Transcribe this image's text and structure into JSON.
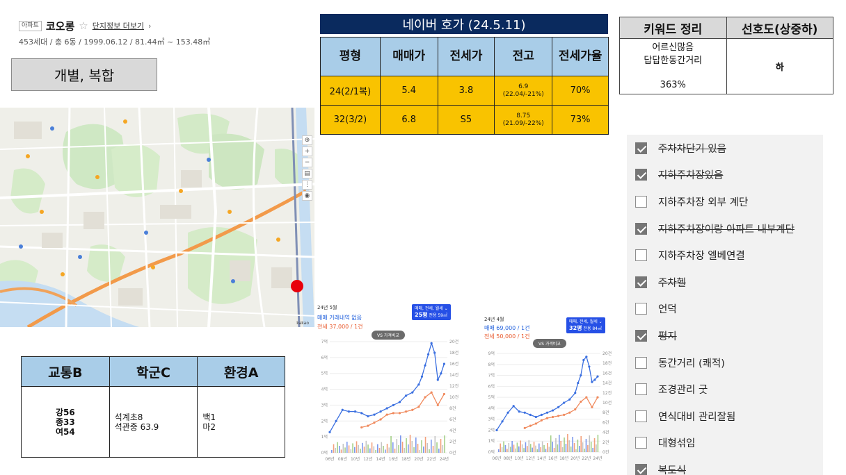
{
  "apartment": {
    "type_badge": "아파트",
    "name": "코오롱",
    "complex_link": "단지정보 더보기",
    "meta": "453세대 / 총 6동 / 1999.06.12 / 81.44㎡ ~ 153.48㎡",
    "category": "개별, 복합"
  },
  "price_table": {
    "title": "네이버 호가 (24.5.11)",
    "headers": [
      "평형",
      "매매가",
      "전세가",
      "전고",
      "전세가율"
    ],
    "rows": [
      {
        "size": "24(2/1복)",
        "sale": "5.4",
        "jeonse": "3.8",
        "high": "6.9",
        "high_sub": "(22.04/-21%)",
        "ratio": "70%"
      },
      {
        "size": "32(3/2)",
        "sale": "6.8",
        "jeonse": "S5",
        "high": "8.75",
        "high_sub": "(21.09/-22%)",
        "ratio": "73%"
      }
    ]
  },
  "keyword_table": {
    "headers": [
      "키워드 정리",
      "선호도(상중하)"
    ],
    "keywords_line1": "어르신많음",
    "keywords_line2": "답답한동간거리",
    "rate": "363%",
    "preference": "하"
  },
  "checklist": [
    {
      "label": "주차차단기 있음",
      "checked": true,
      "struck": true
    },
    {
      "label": "지하주차장있음",
      "checked": true,
      "struck": true
    },
    {
      "label": "지하주차장 외부 계단",
      "checked": false,
      "struck": false
    },
    {
      "label": "지하주차장이랑 아파트 내부계단",
      "checked": true,
      "struck": true
    },
    {
      "label": "지하주차장 엘베연결",
      "checked": false,
      "struck": false
    },
    {
      "label": "주차헬",
      "checked": true,
      "struck": true
    },
    {
      "label": "언덕",
      "checked": false,
      "struck": false
    },
    {
      "label": "평지",
      "checked": true,
      "struck": true
    },
    {
      "label": "동간거리 (쾌적)",
      "checked": false,
      "struck": false
    },
    {
      "label": "조경관리 굿",
      "checked": false,
      "struck": false
    },
    {
      "label": "연식대비 관리잘됨",
      "checked": false,
      "struck": false
    },
    {
      "label": "대형섞임",
      "checked": false,
      "struck": false
    },
    {
      "label": "복도식",
      "checked": true,
      "struck": true
    }
  ],
  "score_table": {
    "headers": [
      "교통B",
      "학군C",
      "환경A"
    ],
    "transport": [
      "강56",
      "종33",
      "여54"
    ],
    "school": [
      "석계초8",
      "석관중 63.9"
    ],
    "environment": [
      "백1",
      "마2"
    ]
  },
  "map": {
    "scale_label": "kakao",
    "marker_color": "#e8000b"
  },
  "chart_data": [
    {
      "type": "line",
      "period": "24년 5월",
      "sale_text": "매매 거래내역 없음",
      "jeonse_text": "전세 37,000 / 1건",
      "filter_label": "매매, 전세, 월세",
      "size_label": "25평",
      "size_sub": "전용 59㎡",
      "compare_button": "VS 가격비교",
      "y_left_ticks": [
        "7억",
        "6억",
        "5억",
        "4억",
        "3억",
        "2억",
        "1억",
        "0억"
      ],
      "y_right_ticks": [
        "20건",
        "18건",
        "16건",
        "14건",
        "12건",
        "10건",
        "8건",
        "6건",
        "4건",
        "2건",
        "0건"
      ],
      "x_ticks": [
        "06년",
        "08년",
        "10년",
        "12년",
        "14년",
        "16년",
        "18년",
        "20년",
        "22년",
        "24년"
      ],
      "ylim": [
        0,
        7
      ],
      "series": [
        {
          "name": "매매",
          "color": "#3a6fe0",
          "x": [
            2006,
            2007,
            2008,
            2009,
            2010,
            2011,
            2012,
            2013,
            2014,
            2015,
            2016,
            2017,
            2018,
            2019,
            2020,
            2020.5,
            2021,
            2021.5,
            2022,
            2022.5,
            2023,
            2023.5,
            2024
          ],
          "values": [
            1.3,
            2.0,
            2.7,
            2.6,
            2.6,
            2.5,
            2.3,
            2.4,
            2.6,
            2.8,
            3.0,
            3.2,
            3.6,
            3.8,
            4.3,
            4.8,
            5.5,
            6.2,
            6.9,
            6.3,
            4.6,
            5.0,
            5.6
          ]
        },
        {
          "name": "전세",
          "color": "#f08a5d",
          "x": [
            2011,
            2012,
            2013,
            2014,
            2015,
            2016,
            2017,
            2018,
            2019,
            2020,
            2021,
            2022,
            2023,
            2024
          ],
          "values": [
            1.6,
            1.7,
            1.9,
            2.1,
            2.4,
            2.5,
            2.5,
            2.6,
            2.7,
            2.9,
            3.5,
            3.8,
            3.0,
            3.7
          ]
        }
      ]
    },
    {
      "type": "line",
      "period": "24년 4월",
      "sale_text": "매매 69,000 / 1건",
      "jeonse_text": "전세 50,000 / 1건",
      "filter_label": "매매, 전세, 월세",
      "size_label": "32평",
      "size_sub": "전용 84㎡",
      "compare_button": "VS 가격비교",
      "y_left_ticks": [
        "9억",
        "8억",
        "7억",
        "6억",
        "5억",
        "4억",
        "3억",
        "2억",
        "1억",
        "0억"
      ],
      "y_right_ticks": [
        "20건",
        "18건",
        "16건",
        "14건",
        "12건",
        "10건",
        "8건",
        "6건",
        "4건",
        "2건",
        "0건"
      ],
      "x_ticks": [
        "06년",
        "08년",
        "10년",
        "12년",
        "14년",
        "16년",
        "18년",
        "20년",
        "22년",
        "24년"
      ],
      "ylim": [
        0,
        9
      ],
      "series": [
        {
          "name": "매매",
          "color": "#3a6fe0",
          "x": [
            2006,
            2007,
            2008,
            2009,
            2010,
            2011,
            2012,
            2013,
            2014,
            2015,
            2016,
            2017,
            2018,
            2019,
            2020,
            2020.5,
            2021,
            2021.5,
            2022,
            2022.5,
            2023,
            2023.5,
            2024
          ],
          "values": [
            2.0,
            2.8,
            3.6,
            4.2,
            3.7,
            3.6,
            3.4,
            3.2,
            3.4,
            3.6,
            3.8,
            4.1,
            4.5,
            4.8,
            5.4,
            6.3,
            7.0,
            8.4,
            8.7,
            7.8,
            6.4,
            6.6,
            6.9
          ]
        },
        {
          "name": "전세",
          "color": "#f08a5d",
          "x": [
            2011,
            2012,
            2013,
            2014,
            2015,
            2016,
            2017,
            2018,
            2019,
            2020,
            2021,
            2022,
            2023,
            2024
          ],
          "values": [
            2.2,
            2.4,
            2.6,
            2.9,
            3.1,
            3.2,
            3.3,
            3.4,
            3.6,
            3.9,
            4.6,
            5.0,
            4.1,
            5.0
          ]
        }
      ]
    }
  ]
}
